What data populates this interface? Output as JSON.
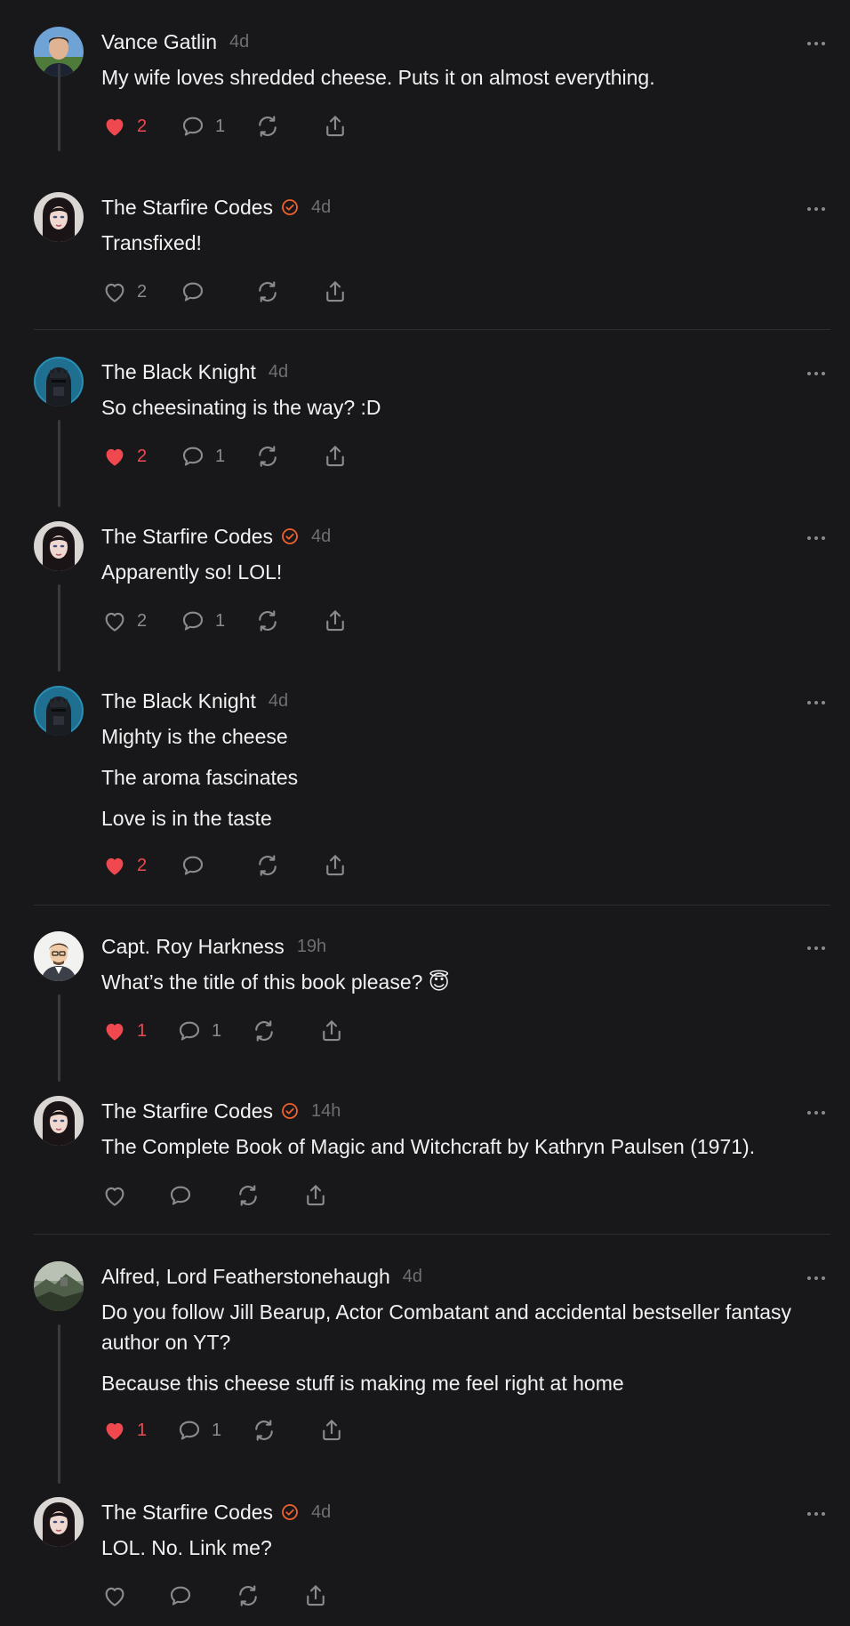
{
  "colors": {
    "background": "#18181a",
    "like_active": "#f0484f",
    "verified_badge": "#f0622d",
    "muted": "#8a8a8f"
  },
  "posts": [
    {
      "author": "Vance Gatlin",
      "verified": false,
      "time": "4d",
      "lines": [
        "My wife loves shredded cheese. Puts it on almost everything."
      ],
      "liked": true,
      "likes": "2",
      "replies": "1",
      "avatar": "photo-man"
    },
    {
      "author": "The Starfire Codes",
      "verified": true,
      "time": "4d",
      "lines": [
        "Transfixed!"
      ],
      "liked": false,
      "likes": "2",
      "replies": "",
      "avatar": "woman-dark-hair"
    },
    {
      "author": "The Black Knight",
      "verified": false,
      "time": "4d",
      "lines": [
        "So cheesinating is the way? :D"
      ],
      "liked": true,
      "likes": "2",
      "replies": "1",
      "avatar": "black-knight"
    },
    {
      "author": "The Starfire Codes",
      "verified": true,
      "time": "4d",
      "lines": [
        "Apparently so! LOL!"
      ],
      "liked": false,
      "likes": "2",
      "replies": "1",
      "avatar": "woman-dark-hair"
    },
    {
      "author": "The Black Knight",
      "verified": false,
      "time": "4d",
      "lines": [
        "Mighty is the cheese",
        "The aroma fascinates",
        "Love is in the taste"
      ],
      "liked": true,
      "likes": "2",
      "replies": "",
      "avatar": "black-knight"
    },
    {
      "author": "Capt. Roy Harkness",
      "verified": false,
      "time": "19h",
      "lines": [
        "What’s the title of this book please? 😇"
      ],
      "liked": true,
      "likes": "1",
      "replies": "1",
      "avatar": "cartoon-man"
    },
    {
      "author": "The Starfire Codes",
      "verified": true,
      "time": "14h",
      "lines": [
        "The Complete Book of Magic and Witchcraft by Kathryn Paulsen (1971)."
      ],
      "liked": false,
      "likes": "",
      "replies": "",
      "avatar": "woman-dark-hair"
    },
    {
      "author": "Alfred, Lord Featherstonehaugh",
      "verified": false,
      "time": "4d",
      "lines": [
        "Do you follow Jill Bearup, Actor Combatant and accidental bestseller fantasy author on YT?",
        "Because this cheese stuff is making me feel right at home"
      ],
      "liked": true,
      "likes": "1",
      "replies": "1",
      "avatar": "landscape"
    },
    {
      "author": "The Starfire Codes",
      "verified": true,
      "time": "4d",
      "lines": [
        "LOL. No. Link me?"
      ],
      "liked": false,
      "likes": "",
      "replies": "",
      "avatar": "woman-dark-hair"
    }
  ]
}
